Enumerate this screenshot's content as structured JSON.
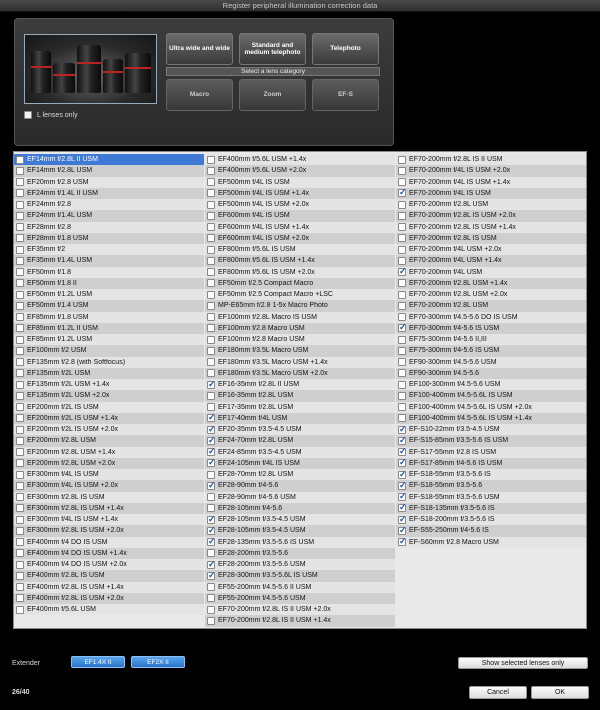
{
  "window": {
    "title": "Register peripheral illumination correction data"
  },
  "categories": {
    "label": "Select a lens category",
    "buttons": [
      "Ultra wide and wide",
      "Standard and medium telephoto",
      "Telephoto",
      "Macro",
      "Zoom",
      "EF-S"
    ]
  },
  "l_lenses_only": {
    "label": "L lenses only",
    "checked": false
  },
  "columns": [
    [
      {
        "name": "EF14mm f/2.8L II USM",
        "checked": false,
        "selected": true
      },
      {
        "name": "EF14mm f/2.8L USM",
        "checked": false
      },
      {
        "name": "EF20mm f/2.8 USM",
        "checked": false
      },
      {
        "name": "EF24mm f/1.4L II USM",
        "checked": false
      },
      {
        "name": "EF24mm f/2.8",
        "checked": false
      },
      {
        "name": "EF24mm f/1.4L USM",
        "checked": false
      },
      {
        "name": "EF28mm f/2.8",
        "checked": false
      },
      {
        "name": "EF28mm f/1.8 USM",
        "checked": false
      },
      {
        "name": "EF35mm f/2",
        "checked": false
      },
      {
        "name": "EF35mm f/1.4L USM",
        "checked": false
      },
      {
        "name": "EF50mm f/1.8",
        "checked": false
      },
      {
        "name": "EF50mm f/1.8 II",
        "checked": false
      },
      {
        "name": "EF50mm f/1.2L USM",
        "checked": false
      },
      {
        "name": "EF50mm f/1.4 USM",
        "checked": false
      },
      {
        "name": "EF85mm f/1.8 USM",
        "checked": false
      },
      {
        "name": "EF85mm f/1.2L II USM",
        "checked": false
      },
      {
        "name": "EF85mm f/1.2L USM",
        "checked": false
      },
      {
        "name": "EF100mm f/2 USM",
        "checked": false
      },
      {
        "name": "EF135mm f/2.8 (with Softfocus)",
        "checked": false
      },
      {
        "name": "EF135mm f/2L USM",
        "checked": false
      },
      {
        "name": "EF135mm f/2L USM +1.4x",
        "checked": false
      },
      {
        "name": "EF135mm f/2L USM +2.0x",
        "checked": false
      },
      {
        "name": "EF200mm f/2L IS USM",
        "checked": false
      },
      {
        "name": "EF200mm f/2L IS USM +1.4x",
        "checked": false
      },
      {
        "name": "EF200mm f/2L IS USM +2.0x",
        "checked": false
      },
      {
        "name": "EF200mm f/2.8L USM",
        "checked": false
      },
      {
        "name": "EF200mm f/2.8L USM +1.4x",
        "checked": false
      },
      {
        "name": "EF200mm f/2.8L USM +2.0x",
        "checked": false
      },
      {
        "name": "EF300mm f/4L IS USM",
        "checked": false
      },
      {
        "name": "EF300mm f/4L IS USM +2.0x",
        "checked": false
      },
      {
        "name": "EF300mm f/2.8L IS USM",
        "checked": false
      },
      {
        "name": "EF300mm f/2.8L IS USM +1.4x",
        "checked": false
      },
      {
        "name": "EF300mm f/4L IS USM +1.4x",
        "checked": false
      },
      {
        "name": "EF300mm f/2.8L IS USM +2.0x",
        "checked": false
      },
      {
        "name": "EF400mm f/4 DO IS USM",
        "checked": false
      },
      {
        "name": "EF400mm f/4 DO IS USM +1.4x",
        "checked": false
      },
      {
        "name": "EF400mm f/4 DO IS USM +2.0x",
        "checked": false
      },
      {
        "name": "EF400mm f/2.8L IS USM",
        "checked": false
      },
      {
        "name": "EF400mm f/2.8L IS USM +1.4x",
        "checked": false
      },
      {
        "name": "EF400mm f/2.8L IS USM +2.0x",
        "checked": false
      },
      {
        "name": "EF400mm f/5.6L USM",
        "checked": false
      }
    ],
    [
      {
        "name": "EF400mm f/5.6L USM +1.4x",
        "checked": false
      },
      {
        "name": "EF400mm f/5.6L USM +2.0x",
        "checked": false
      },
      {
        "name": "EF500mm f/4L IS USM",
        "checked": false
      },
      {
        "name": "EF500mm f/4L IS USM +1.4x",
        "checked": false
      },
      {
        "name": "EF500mm f/4L IS USM +2.0x",
        "checked": false
      },
      {
        "name": "EF600mm f/4L IS USM",
        "checked": false
      },
      {
        "name": "EF600mm f/4L IS USM +1.4x",
        "checked": false
      },
      {
        "name": "EF600mm f/4L IS USM +2.0x",
        "checked": false
      },
      {
        "name": "EF800mm f/5.6L IS USM",
        "checked": false
      },
      {
        "name": "EF800mm f/5.6L IS USM +1.4x",
        "checked": false
      },
      {
        "name": "EF800mm f/5.6L IS USM +2.0x",
        "checked": false
      },
      {
        "name": "EF50mm f/2.5 Compact Macro",
        "checked": false
      },
      {
        "name": "EF50mm f/2.5 Compact Macro +LSC",
        "checked": false
      },
      {
        "name": "MP-E65mm f/2.8 1-5x Macro Photo",
        "checked": false
      },
      {
        "name": "EF100mm f/2.8L Macro IS USM",
        "checked": false
      },
      {
        "name": "EF100mm f/2.8 Macro USM",
        "checked": false
      },
      {
        "name": "EF100mm f/2.8 Macro USM",
        "checked": false
      },
      {
        "name": "EF180mm f/3.5L Macro USM",
        "checked": false
      },
      {
        "name": "EF180mm f/3.5L Macro USM +1.4x",
        "checked": false
      },
      {
        "name": "EF180mm f/3.5L Macro USM +2.0x",
        "checked": false
      },
      {
        "name": "EF16-35mm f/2.8L II USM",
        "checked": true
      },
      {
        "name": "EF16-35mm f/2.8L USM",
        "checked": false
      },
      {
        "name": "EF17-35mm f/2.8L USM",
        "checked": false
      },
      {
        "name": "EF17-40mm f/4L USM",
        "checked": true
      },
      {
        "name": "EF20-35mm f/3.5-4.5 USM",
        "checked": true
      },
      {
        "name": "EF24-70mm f/2.8L USM",
        "checked": true
      },
      {
        "name": "EF24-85mm f/3.5-4.5 USM",
        "checked": true
      },
      {
        "name": "EF24-105mm f/4L IS USM",
        "checked": true
      },
      {
        "name": "EF28-70mm f/2.8L USM",
        "checked": false
      },
      {
        "name": "EF28-90mm f/4-5.6",
        "checked": true
      },
      {
        "name": "EF28-90mm f/4-5.6 USM",
        "checked": false
      },
      {
        "name": "EF28-105mm f/4-5.6",
        "checked": false
      },
      {
        "name": "EF28-105mm f/3.5-4.5 USM",
        "checked": true
      },
      {
        "name": "EF28-105mm f/3.5-4.5 USM",
        "checked": true
      },
      {
        "name": "EF28-135mm f/3.5-5.6 IS USM",
        "checked": true
      },
      {
        "name": "EF28-200mm f/3.5-5.6",
        "checked": false
      },
      {
        "name": "EF28-200mm f/3.5-5.6 USM",
        "checked": true
      },
      {
        "name": "EF28-300mm f/3.5-5.6L IS USM",
        "checked": true
      },
      {
        "name": "EF55-200mm f/4.5-5.6 II USM",
        "checked": false
      },
      {
        "name": "EF55-200mm f/4.5-5.6 USM",
        "checked": false
      },
      {
        "name": "EF70-200mm f/2.8L IS II USM +2.0x",
        "checked": false
      },
      {
        "name": "EF70-200mm f/2.8L IS II USM +1.4x",
        "checked": false
      }
    ],
    [
      {
        "name": "EF70-200mm f/2.8L IS II USM",
        "checked": false
      },
      {
        "name": "EF70-200mm f/4L IS USM +2.0x",
        "checked": false
      },
      {
        "name": "EF70-200mm f/4L IS USM +1.4x",
        "checked": false
      },
      {
        "name": "EF70-200mm f/4L IS USM",
        "checked": true
      },
      {
        "name": "EF70-200mm f/2.8L USM",
        "checked": false
      },
      {
        "name": "EF70-200mm f/2.8L IS USM +2.0x",
        "checked": false
      },
      {
        "name": "EF70-200mm f/2.8L IS USM +1.4x",
        "checked": false
      },
      {
        "name": "EF70-200mm f/2.8L IS USM",
        "checked": false
      },
      {
        "name": "EF70-200mm f/4L USM +2.0x",
        "checked": false
      },
      {
        "name": "EF70-200mm f/4L USM +1.4x",
        "checked": false
      },
      {
        "name": "EF70-200mm f/4L USM",
        "checked": true
      },
      {
        "name": "EF70-200mm f/2.8L USM +1.4x",
        "checked": false
      },
      {
        "name": "EF70-200mm f/2.8L USM +2.0x",
        "checked": false
      },
      {
        "name": "EF70-200mm f/2.8L USM",
        "checked": false
      },
      {
        "name": "EF70-300mm f/4.5-5.6 DO IS USM",
        "checked": false
      },
      {
        "name": "EF70-300mm f/4-5.6 IS USM",
        "checked": true
      },
      {
        "name": "EF75-300mm f/4-5.6 II,III",
        "checked": false
      },
      {
        "name": "EF75-300mm f/4-5.6 IS USM",
        "checked": false
      },
      {
        "name": "EF90-300mm f/4.5-5.6 USM",
        "checked": false
      },
      {
        "name": "EF90-300mm f/4.5-5.6",
        "checked": false
      },
      {
        "name": "EF100-300mm f/4.5-5.6 USM",
        "checked": false
      },
      {
        "name": "EF100-400mm f/4.5-5.6L IS USM",
        "checked": false
      },
      {
        "name": "EF100-400mm f/4.5-5.6L IS USM +2.0x",
        "checked": false
      },
      {
        "name": "EF100-400mm f/4.5-5.6L IS USM +1.4x",
        "checked": false
      },
      {
        "name": "EF-S10-22mm f/3.5-4.5 USM",
        "checked": true
      },
      {
        "name": "EF-S15-85mm f/3.5-5.6 IS USM",
        "checked": true
      },
      {
        "name": "EF-S17-55mm f/2.8 IS USM",
        "checked": true
      },
      {
        "name": "EF-S17-85mm f/4-5.6 IS USM",
        "checked": true
      },
      {
        "name": "EF-S18-55mm f/3.5-5.6 IS",
        "checked": true
      },
      {
        "name": "EF-S18-55mm f/3.5-5.6",
        "checked": true
      },
      {
        "name": "EF-S18-55mm f/3.5-5.6 USM",
        "checked": true
      },
      {
        "name": "EF-S18-135mm f/3.5-5.6 IS",
        "checked": true
      },
      {
        "name": "EF-S18-200mm f/3.5-5.6 IS",
        "checked": true
      },
      {
        "name": "EF-S55-250mm f/4-5.6 IS",
        "checked": true
      },
      {
        "name": "EF-S60mm f/2.8 Macro USM",
        "checked": true
      }
    ]
  ],
  "extender": {
    "label": "Extender",
    "options": [
      "EF1.4X II",
      "EF2X II"
    ]
  },
  "show_selected_button": "Show selected lenses only",
  "count": "26/40",
  "buttons": {
    "cancel": "Cancel",
    "ok": "OK"
  }
}
